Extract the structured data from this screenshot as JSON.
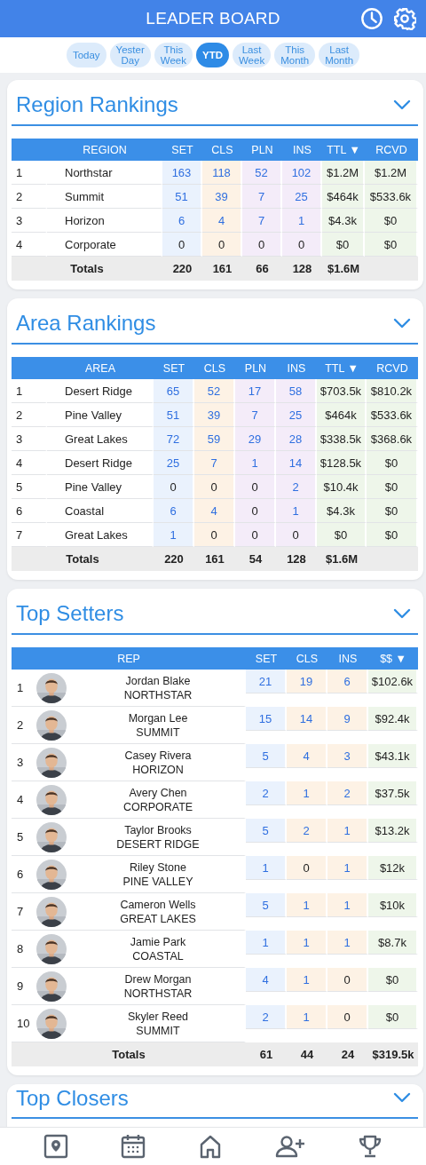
{
  "header": {
    "title": "LEADER BOARD"
  },
  "periods": [
    {
      "label": "Today",
      "selected": false
    },
    {
      "label": "Yester Day",
      "selected": false
    },
    {
      "label": "This Week",
      "selected": false
    },
    {
      "label": "YTD",
      "selected": true
    },
    {
      "label": "Last Week",
      "selected": false
    },
    {
      "label": "This Month",
      "selected": false
    },
    {
      "label": "Last Month",
      "selected": false
    }
  ],
  "sections": [
    {
      "title": "Region Rankings",
      "table": {
        "kind": "simple",
        "columns": [
          {
            "label": "REGION",
            "kind": "name"
          },
          {
            "label": "SET",
            "kind": "count",
            "color": "#eaf2fd"
          },
          {
            "label": "CLS",
            "kind": "count",
            "color": "#fdf2e5"
          },
          {
            "label": "PLN",
            "kind": "count",
            "color": "#f4ecf9"
          },
          {
            "label": "INS",
            "kind": "count",
            "color": "#f4ecf9"
          },
          {
            "label": "TTL ▼",
            "kind": "money",
            "color": "#eef6ea"
          },
          {
            "label": "RCVD",
            "kind": "money",
            "color": "#eef6ea"
          }
        ],
        "rows": [
          {
            "rank": "1",
            "name": "Northstar",
            "values": [
              "163",
              "118",
              "52",
              "102",
              "$1.2M",
              "$1.2M"
            ]
          },
          {
            "rank": "2",
            "name": "Summit",
            "values": [
              "51",
              "39",
              "7",
              "25",
              "$464k",
              "$533.6k"
            ]
          },
          {
            "rank": "3",
            "name": "Horizon",
            "values": [
              "6",
              "4",
              "7",
              "1",
              "$4.3k",
              "$0"
            ]
          },
          {
            "rank": "4",
            "name": "Corporate",
            "values": [
              "0",
              "0",
              "0",
              "0",
              "$0",
              "$0"
            ]
          }
        ],
        "totals": {
          "label": "Totals",
          "values": [
            "220",
            "161",
            "66",
            "128",
            "$1.6M"
          ]
        }
      }
    },
    {
      "title": "Area Rankings",
      "table": {
        "kind": "simple",
        "columns": [
          {
            "label": "AREA",
            "kind": "name"
          },
          {
            "label": "SET",
            "kind": "count",
            "color": "#eaf2fd"
          },
          {
            "label": "CLS",
            "kind": "count",
            "color": "#fdf2e5"
          },
          {
            "label": "PLN",
            "kind": "count",
            "color": "#f4ecf9"
          },
          {
            "label": "INS",
            "kind": "count",
            "color": "#f4ecf9"
          },
          {
            "label": "TTL ▼",
            "kind": "money",
            "color": "#eef6ea"
          },
          {
            "label": "RCVD",
            "kind": "money",
            "color": "#eef6ea"
          }
        ],
        "rows": [
          {
            "rank": "1",
            "name": "Desert Ridge",
            "values": [
              "65",
              "52",
              "17",
              "58",
              "$703.5k",
              "$810.2k"
            ]
          },
          {
            "rank": "2",
            "name": "Pine Valley",
            "values": [
              "51",
              "39",
              "7",
              "25",
              "$464k",
              "$533.6k"
            ]
          },
          {
            "rank": "3",
            "name": "Great Lakes",
            "values": [
              "72",
              "59",
              "29",
              "28",
              "$338.5k",
              "$368.6k"
            ]
          },
          {
            "rank": "4",
            "name": "Desert Ridge",
            "values": [
              "25",
              "7",
              "1",
              "14",
              "$128.5k",
              "$0"
            ]
          },
          {
            "rank": "5",
            "name": "Pine Valley",
            "values": [
              "0",
              "0",
              "0",
              "2",
              "$10.4k",
              "$0"
            ]
          },
          {
            "rank": "6",
            "name": "Coastal",
            "values": [
              "6",
              "4",
              "0",
              "1",
              "$4.3k",
              "$0"
            ]
          },
          {
            "rank": "7",
            "name": "Great Lakes",
            "values": [
              "1",
              "0",
              "0",
              "0",
              "$0",
              "$0"
            ]
          }
        ],
        "totals": {
          "label": "Totals",
          "values": [
            "220",
            "161",
            "54",
            "128",
            "$1.6M"
          ]
        }
      }
    },
    {
      "title": "Top Setters",
      "table": {
        "kind": "rep",
        "columns": [
          {
            "label": "REP",
            "kind": "name"
          },
          {
            "label": "SET",
            "kind": "count",
            "color": "#eaf2fd"
          },
          {
            "label": "CLS",
            "kind": "count",
            "color": "#fdf2e5"
          },
          {
            "label": "INS",
            "kind": "count",
            "color": "#fdf2e5"
          },
          {
            "label": "$$ ▼",
            "kind": "money",
            "color": "#eef6ea"
          }
        ],
        "rows": [
          {
            "rank": "1",
            "name": "Jordan Blake",
            "area": "NORTHSTAR",
            "values": [
              "21",
              "19",
              "6",
              "$102.6k"
            ]
          },
          {
            "rank": "2",
            "name": "Morgan Lee",
            "area": "SUMMIT",
            "values": [
              "15",
              "14",
              "9",
              "$92.4k"
            ]
          },
          {
            "rank": "3",
            "name": "Casey Rivera",
            "area": "HORIZON",
            "values": [
              "5",
              "4",
              "3",
              "$43.1k"
            ]
          },
          {
            "rank": "4",
            "name": "Avery Chen",
            "area": "CORPORATE",
            "values": [
              "2",
              "1",
              "2",
              "$37.5k"
            ]
          },
          {
            "rank": "5",
            "name": "Taylor Brooks",
            "area": "DESERT RIDGE",
            "values": [
              "5",
              "2",
              "1",
              "$13.2k"
            ]
          },
          {
            "rank": "6",
            "name": "Riley Stone",
            "area": "PINE VALLEY",
            "values": [
              "1",
              "0",
              "1",
              "$12k"
            ]
          },
          {
            "rank": "7",
            "name": "Cameron Wells",
            "area": "GREAT LAKES",
            "values": [
              "5",
              "1",
              "1",
              "$10k"
            ]
          },
          {
            "rank": "8",
            "name": "Jamie Park",
            "area": "COASTAL",
            "values": [
              "1",
              "1",
              "1",
              "$8.7k"
            ]
          },
          {
            "rank": "9",
            "name": "Drew Morgan",
            "area": "NORTHSTAR",
            "values": [
              "4",
              "1",
              "0",
              "$0"
            ]
          },
          {
            "rank": "10",
            "name": "Skyler Reed",
            "area": "SUMMIT",
            "values": [
              "2",
              "1",
              "0",
              "$0"
            ]
          }
        ],
        "totals": {
          "label": "Totals",
          "values": [
            "61",
            "44",
            "24",
            "$319.5k"
          ]
        }
      }
    },
    {
      "title": "Top Closers"
    }
  ]
}
